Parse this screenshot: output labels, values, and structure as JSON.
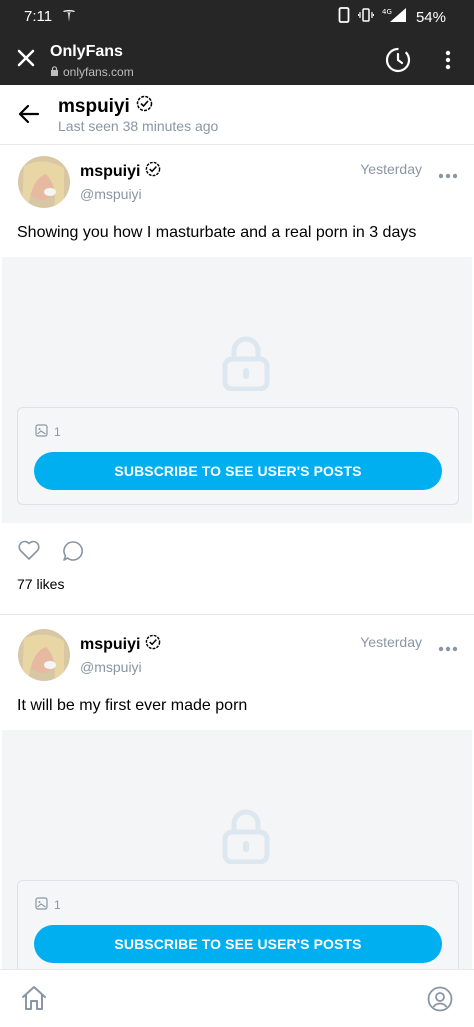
{
  "status_bar": {
    "time": "7:11",
    "network": "4G",
    "battery": "54%",
    "icons": [
      "tesla-icon",
      "phone-icon",
      "vibrate-icon",
      "signal-icon"
    ]
  },
  "browser": {
    "title": "OnlyFans",
    "url": "onlyfans.com",
    "icons": [
      "close-icon",
      "lock-icon",
      "history-icon",
      "more-vert-icon"
    ]
  },
  "header": {
    "name": "mspuiyi",
    "last_seen": "Last seen 38 minutes ago",
    "icons": [
      "back-arrow-icon",
      "verified-icon"
    ]
  },
  "posts": [
    {
      "author": "mspuiyi",
      "handle": "@mspuiyi",
      "date": "Yesterday",
      "text": "Showing you how I masturbate and a real porn in 3 days",
      "media_count": "1",
      "subscribe_label": "SUBSCRIBE TO SEE USER'S POSTS",
      "likes": "77 likes",
      "subscribe_color": "#00aff0"
    },
    {
      "author": "mspuiyi",
      "handle": "@mspuiyi",
      "date": "Yesterday",
      "text": "It will be my first ever made porn",
      "media_count": "1",
      "subscribe_label": "SUBSCRIBE TO SEE USER'S POSTS",
      "subscribe_color": "#00aff0"
    }
  ],
  "bottom_nav": {
    "icons": [
      "home-icon",
      "profile-icon"
    ]
  },
  "colors": {
    "accent": "#00aff0",
    "muted": "#8a96a3",
    "chrome": "#262626"
  }
}
